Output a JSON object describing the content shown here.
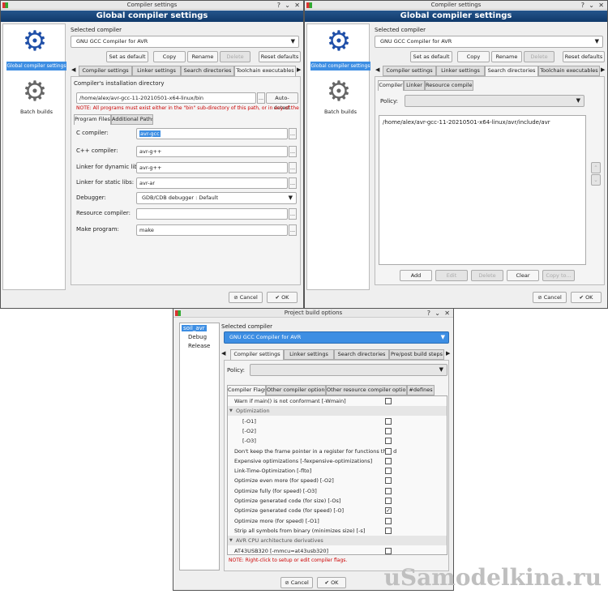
{
  "win1": {
    "title": "Compiler settings",
    "header": "Global compiler settings",
    "sidebar": {
      "item1": "Global compiler settings",
      "item2": "Batch builds"
    },
    "selected_label": "Selected compiler",
    "compiler": "GNU GCC Compiler for AVR",
    "buttons": {
      "default": "Set as default",
      "copy": "Copy",
      "rename": "Rename",
      "delete": "Delete",
      "reset": "Reset defaults"
    },
    "tabs": [
      "Compiler settings",
      "Linker settings",
      "Search directories",
      "Toolchain executables"
    ],
    "install_label": "Compiler's installation directory",
    "install_path": "/home/alex/avr-gcc-11-20210501-x64-linux/bin",
    "autodetect": "Auto-detect",
    "note": "NOTE: All programs must exist either in the \"bin\" sub-directory of this path, or in any of the",
    "subtabs": [
      "Program Files",
      "Additional Paths"
    ],
    "fields": [
      {
        "label": "C compiler:",
        "value": "avr-gcc"
      },
      {
        "label": "C++ compiler:",
        "value": "avr-g++"
      },
      {
        "label": "Linker for dynamic libs:",
        "value": "avr-g++"
      },
      {
        "label": "Linker for static libs:",
        "value": "avr-ar"
      }
    ],
    "debugger_label": "Debugger:",
    "debugger": "GDB/CDB debugger : Default",
    "resource_label": "Resource compiler:",
    "resource": "",
    "make_label": "Make program:",
    "make": "make",
    "cancel": "Cancel",
    "ok": "OK"
  },
  "win2": {
    "title": "Compiler settings",
    "header": "Global compiler settings",
    "sidebar": {
      "item1": "Global compiler settings",
      "item2": "Batch builds"
    },
    "selected_label": "Selected compiler",
    "compiler": "GNU GCC Compiler for AVR",
    "buttons": {
      "default": "Set as default",
      "copy": "Copy",
      "rename": "Rename",
      "delete": "Delete",
      "reset": "Reset defaults"
    },
    "tabs": [
      "Compiler settings",
      "Linker settings",
      "Search directories",
      "Toolchain executables"
    ],
    "subtabs": [
      "Compiler",
      "Linker",
      "Resource compiler"
    ],
    "policy_label": "Policy:",
    "dir": "/home/alex/avr-gcc-11-20210501-x64-linux/avr/include/avr",
    "dirbuttons": {
      "add": "Add",
      "edit": "Edit",
      "delete": "Delete",
      "clear": "Clear",
      "copy": "Copy to..."
    },
    "cancel": "Cancel",
    "ok": "OK"
  },
  "win3": {
    "title": "Project build options",
    "tree": {
      "root": "soil_avr",
      "debug": "Debug",
      "release": "Release"
    },
    "selected_label": "Selected compiler",
    "compiler": "GNU GCC Compiler for AVR",
    "tabs": [
      "Compiler settings",
      "Linker settings",
      "Search directories",
      "Pre/post build steps"
    ],
    "policy_label": "Policy:",
    "subtabs": [
      "Compiler Flags",
      "Other compiler options",
      "Other resource compiler options",
      "#defines"
    ],
    "flags": [
      {
        "text": "Warn if main() is not conformant  [-Wmain]",
        "type": "flag",
        "checked": false
      },
      {
        "text": "Optimization",
        "type": "group"
      },
      {
        "text": "[-O1]",
        "type": "flag",
        "checked": false,
        "indent": true
      },
      {
        "text": "[-O2]",
        "type": "flag",
        "checked": false,
        "indent": true
      },
      {
        "text": "[-O3]",
        "type": "flag",
        "checked": false,
        "indent": true
      },
      {
        "text": "Don't keep the frame pointer in a register for functions that d",
        "type": "flag",
        "checked": false
      },
      {
        "text": "Expensive optimizations  [-fexpensive-optimizations]",
        "type": "flag",
        "checked": false
      },
      {
        "text": "Link-Time-Optimization  [-flto]",
        "type": "flag",
        "checked": false
      },
      {
        "text": "Optimize even more (for speed)  [-O2]",
        "type": "flag",
        "checked": false
      },
      {
        "text": "Optimize fully (for speed)  [-O3]",
        "type": "flag",
        "checked": false
      },
      {
        "text": "Optimize generated code (for size)  [-Os]",
        "type": "flag",
        "checked": false
      },
      {
        "text": "Optimize generated code (for speed)  [-O]",
        "type": "flag",
        "checked": true
      },
      {
        "text": "Optimize more (for speed)  [-O1]",
        "type": "flag",
        "checked": false
      },
      {
        "text": "Strip all symbols from binary (minimizes size)  [-s]",
        "type": "flag",
        "checked": false
      },
      {
        "text": "AVR CPU architecture derivatives",
        "type": "group"
      },
      {
        "text": "AT43USB320  [-mmcu=at43usb320]",
        "type": "flag",
        "checked": false
      }
    ],
    "note": "NOTE: Right-click to setup or edit compiler flags.",
    "cancel": "Cancel",
    "ok": "OK"
  },
  "watermark": "uSamodelkina.ru",
  "colors": {
    "header": "#1b4a80",
    "selection": "#3d8ee3",
    "note": "#cc0000"
  }
}
